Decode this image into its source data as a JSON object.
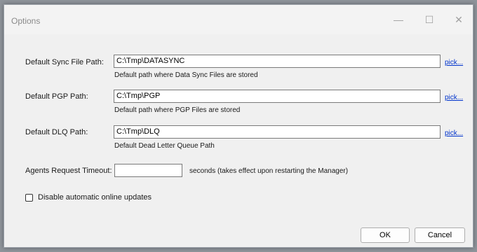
{
  "window": {
    "title": "Options",
    "controls": {
      "minimize": "—",
      "maximize": "☐",
      "close": "✕"
    }
  },
  "fields": [
    {
      "label": "Default Sync File Path:",
      "value": "C:\\Tmp\\DATASYNC",
      "hint": "Default path where Data Sync Files are stored",
      "pick": "pick..."
    },
    {
      "label": "Default PGP Path:",
      "value": "C:\\Tmp\\PGP",
      "hint": "Default path where PGP Files are stored",
      "pick": "pick..."
    },
    {
      "label": "Default DLQ Path:",
      "value": "C:\\Tmp\\DLQ",
      "hint": "Default Dead Letter Queue Path",
      "pick": "pick..."
    }
  ],
  "timeout": {
    "label": "Agents Request Timeout:",
    "value": "",
    "suffix": "seconds (takes effect upon restarting the Manager)"
  },
  "updates": {
    "label": "Disable automatic online updates",
    "checked": false
  },
  "buttons": {
    "ok": "OK",
    "cancel": "Cancel"
  }
}
